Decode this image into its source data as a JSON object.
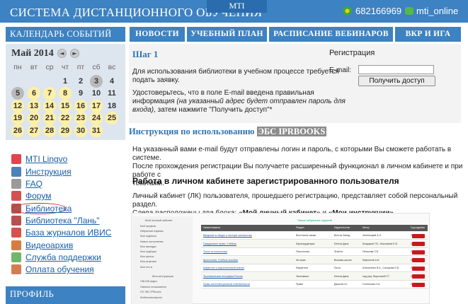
{
  "header": {
    "site_title": "СИСТЕМА ДИСТАНЦИОННОГО ОБУЧЕНИЯ",
    "mti_tab": "MTI",
    "counter": "682166969",
    "online_label": "mti_online"
  },
  "calendar": {
    "heading": "КАЛЕНДАРЬ СОБЫТИЙ",
    "month": "Май 2014",
    "prev": "◄",
    "next": "►",
    "weekdays": [
      "пн",
      "вт",
      "ср",
      "чт",
      "пт",
      "сб",
      "вс"
    ],
    "weeks": [
      [
        "",
        "",
        "",
        "1",
        "2",
        "3",
        "4"
      ],
      [
        "5",
        "6",
        "7",
        "8",
        "9",
        "10",
        "11"
      ],
      [
        "12",
        "13",
        "14",
        "15",
        "16",
        "17",
        "18"
      ],
      [
        "19",
        "20",
        "21",
        "22",
        "23",
        "24",
        "25"
      ],
      [
        "26",
        "27",
        "28",
        "29",
        "30",
        "31",
        ""
      ]
    ]
  },
  "menu": [
    {
      "label": "MTI Lingvo",
      "icon": "lingvo-icon"
    },
    {
      "label": "Инструкция",
      "icon": "instruction-icon"
    },
    {
      "label": "FAQ",
      "icon": "question-icon"
    },
    {
      "label": "Форум",
      "icon": "forum-icon"
    },
    {
      "label": "Библиотека",
      "icon": "library-icon"
    },
    {
      "label": "Библиотека \"Лань\"",
      "icon": "library-lan-icon"
    },
    {
      "label": "База журналов ИВИС",
      "icon": "journals-icon"
    },
    {
      "label": "Видеоархив",
      "icon": "video-icon"
    },
    {
      "label": "Служба поддержки",
      "icon": "support-icon"
    },
    {
      "label": "Оплата обучения",
      "icon": "payment-icon"
    }
  ],
  "profile": {
    "heading": "ПРОФИЛЬ"
  },
  "nav": {
    "news": "НОВОСТИ",
    "curriculum": "УЧЕБНЫЙ ПЛАН",
    "webinars": "РАСПИСАНИЕ ВЕБИНАРОВ",
    "vkr": "ВКР И ИГА"
  },
  "step": {
    "title": "Шаг 1",
    "para1_line1": "Для использования библиотеки в учебном процессе требуется",
    "para1_line2": "подать заявку.",
    "para2_line1": "Удостоверьтесь, что в поле E-mail введена правильная",
    "para2_line2_normal": "информация ",
    "para2_line2_italic": "(на указанный адрес будет отправлен пароль для",
    "para2_line3_italic": "входа)",
    "para2_line3_normal": ", затем нажмите \"Получить доступ\"*"
  },
  "registration": {
    "title": "Регистрация",
    "email_label": "E-mail:",
    "email_value": "",
    "submit": "Получить доступ"
  },
  "instructions": {
    "title_prefix": "Инструкция по использованию ",
    "title_highlight": "ЭБС IPRBOOKS",
    "para_line1": "На указанный вами e-mail будут отправлены логин и пароль, с которыми Вы сможете работать в системе.",
    "para_line2": "После прохождения регистрации Вы получаете расширенный функционал в личном кабинете и при работе с",
    "para_line3": "текстами.",
    "subheading": "Работа в личном кабинете зарегистрированного пользователя",
    "body_line1": "Личный кабинет (ЛК) пользователя, прошедшего регистрацию, представляет собой персональный раздел.",
    "body_line2_prefix": "Слева расположены два блока: ",
    "body_line2_b1": "«Мой личный кабинет»",
    "body_line2_mid": " и ",
    "body_line2_b2": "«Мои инструкции»",
    "body_line2_end": "."
  },
  "thumbnail": {
    "left_title": "Мой личный кабинет",
    "left_items": [
      "Мой профиль",
      "Избранные издания",
      "Мои подписки",
      "Новые поступления",
      "Мои закладки",
      "Мои подборки",
      "Мои цитаты",
      "Мои рецензии",
      "Мои тесты"
    ],
    "left_title2": "Мои инструкции",
    "left_items2": [
      "ONLINE-видео",
      "Памятка пользователя",
      "ПО ЭБС IPRbooks",
      "Мобильная версия"
    ],
    "table_title": "Папка избранных изданий",
    "table_headers": [
      "Наименование",
      "Раздел",
      "Издательство",
      "Автор",
      "Год издания",
      "Действие"
    ],
    "rows": [
      [
        "Введение в общую и частную лингвистику",
        "Восточные языки",
        "Восток-Запад",
        "Зеленецкий А.Л.",
        "2008"
      ],
      [
        "Гражданское право. Учебник",
        "Юриспруденция",
        "Юнити-Дана",
        "Бондарев Г.В., Николаева Е.В.",
        "2012"
      ],
      [
        "Тесты по психологии",
        "Психология",
        "Флинта",
        "Пенькова З.Я.",
        "2012"
      ],
      [
        "Археология. Учебное пособие",
        "История",
        "Высшая школа",
        "Мартынов А.И.",
        "2012"
      ],
      [
        "Маркетинг и маркетинговый анализ",
        "Маркетинг",
        "Логос",
        "Алексеенко В.А., Сахарова Е.В.",
        "2011"
      ],
      [
        "Экономическая география России",
        "Экономика",
        "Юнити-Дана",
        "под ред. Морозовой Т.Г.",
        "2011"
      ],
      [
        "Право интеллектуальной собственности",
        "Право",
        "Дашков и К",
        "Сосенкова О.А.",
        "2011"
      ]
    ],
    "action_label": "удалить"
  }
}
